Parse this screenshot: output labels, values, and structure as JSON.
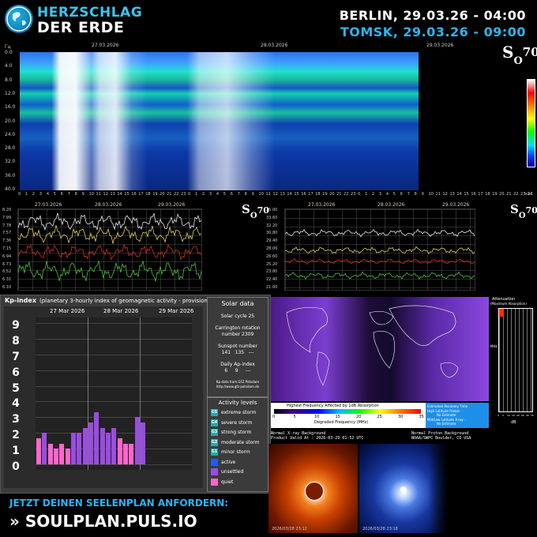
{
  "header": {
    "logo_line1": "HERZSCHLAG",
    "logo_line2": "DER ERDE",
    "city1": "BERLIN, 29.03.26 - 04:00",
    "city2": "TOMSK, 29.03.26 - 09:00"
  },
  "spectrogram": {
    "unit_y": "Гц",
    "unit_x": "час",
    "dates": [
      "27.03.2026",
      "28.03.2026",
      "29.03.2026"
    ],
    "y_ticks": [
      "0.0",
      "4.0",
      "8.0",
      "12.0",
      "16.0",
      "20.0",
      "24.0",
      "28.0",
      "32.0",
      "36.0",
      "40.0"
    ],
    "x_hours": [
      "0",
      "1",
      "2",
      "3",
      "4",
      "5",
      "6",
      "7",
      "8",
      "9",
      "10",
      "11",
      "12",
      "13",
      "14",
      "15",
      "16",
      "17",
      "18",
      "19",
      "20",
      "21",
      "22",
      "23",
      "0",
      "1",
      "2",
      "3",
      "4",
      "5",
      "6",
      "7",
      "8",
      "9",
      "10",
      "11",
      "12",
      "13",
      "14",
      "15",
      "16",
      "17",
      "18",
      "19",
      "20",
      "21",
      "22",
      "23",
      "0",
      "1",
      "2",
      "3",
      "4",
      "5",
      "6",
      "7",
      "8",
      "9",
      "10",
      "11",
      "12",
      "13",
      "14",
      "15",
      "16",
      "17",
      "18",
      "19",
      "20",
      "21",
      "22",
      "23",
      "24"
    ]
  },
  "logo_mark": {
    "s": "S",
    "o": "O",
    "n": "70"
  },
  "plots": {
    "left_dates": [
      "27.03.2026",
      "28.03.2026",
      "29.03.2026"
    ],
    "left_y_ticks": [
      "8.20",
      "7.99",
      "7.78",
      "7.57",
      "7.36",
      "7.15",
      "6.94",
      "6.73",
      "6.52",
      "6.31",
      "6.10"
    ],
    "right_dates": [
      "27.03.2026",
      "28.03.2026",
      "29.03.2026"
    ],
    "right_y_ticks": [
      "35.00",
      "33.60",
      "32.20",
      "30.80",
      "29.40",
      "28.00",
      "26.60",
      "25.20",
      "23.80",
      "22.40",
      "21.00"
    ]
  },
  "kp": {
    "title": "Kp-index",
    "subtitle": "(planetary 3-hourly index of geomagnetic activity - provisional data)",
    "days": [
      "27 Mar 2026",
      "28 Mar 2026",
      "29 Mar 2026"
    ],
    "levels": [
      "9",
      "8",
      "7",
      "6",
      "5",
      "4",
      "3",
      "2",
      "1",
      "0"
    ],
    "values": [
      1.67,
      2.0,
      1.33,
      1.0,
      1.33,
      1.0,
      2.0,
      2.0,
      2.33,
      2.67,
      3.33,
      2.33,
      2.0,
      2.33,
      1.67,
      1.33,
      1.33,
      3.0,
      2.67,
      0,
      0,
      0,
      0,
      0,
      0,
      0,
      0
    ],
    "colors": {
      "quiet": "#ff66cc",
      "unsettled": "#9a4de0",
      "active": "#1e5cff"
    }
  },
  "solar": {
    "title": "Solar data",
    "cycle": "Solar cycle 25",
    "rotation_label": "Carrington rotation",
    "rotation_number": "number 2309",
    "sunspot_label": "Sunspot number",
    "sunspot_values": "141   135   ---",
    "ap_label": "Daily Ap-index",
    "ap_values": "6     9     ---",
    "source1": "Kp-data from GFZ Potsdam",
    "source2": "http://www.gfz-potsdam.de"
  },
  "activity": {
    "title": "Activity levels",
    "rows": [
      {
        "code": "G5",
        "label": "extreme storm",
        "color": "#2aa"
      },
      {
        "code": "G4",
        "label": "severe storm",
        "color": "#2aa"
      },
      {
        "code": "G3",
        "label": "strong storm",
        "color": "#2aa"
      },
      {
        "code": "G2",
        "label": "moderate storm",
        "color": "#2aa"
      },
      {
        "code": "G1",
        "label": "minor storm",
        "color": "#2aa"
      },
      {
        "code": "",
        "label": "active",
        "color": "#1e5cff"
      },
      {
        "code": "",
        "label": "unsettled",
        "color": "#9a4de0"
      },
      {
        "code": "",
        "label": "quiet",
        "color": "#ff66cc"
      }
    ]
  },
  "drap": {
    "legend_title": "Highest Frequency Affected by 1dB Absorption",
    "legend_axis": "Degraded Frequency (MHz)",
    "legend_ticks": [
      "0",
      "5",
      "10",
      "15",
      "20",
      "25",
      "30",
      "35"
    ],
    "recovery_line1": "Estimated Recovery Time",
    "recovery_line2": "High Latitude Proton -",
    "recovery_line3": "No Estimate",
    "recovery_line4": "Mid/Low Latitude X-ray -",
    "recovery_line5": "No Estimate",
    "atten_title": "Attenuation",
    "atten_sub": "(Maximum Absorption)",
    "atten_unit": "dB",
    "atten_x_ticks": [
      "0",
      "5",
      "10",
      "15",
      "20",
      "25",
      "30",
      "35"
    ],
    "mhz_label": "MHz",
    "xray_label1": "Normal X-ray Background",
    "xray_label2": "Product Valid At : 2026-03-29 01:52 UTC",
    "proton_label1": "Normal Proton Background",
    "proton_label2": "NOAA/SWPC Boulder, CO USA"
  },
  "lasco": {
    "left_time": "2026/03/28 23:12",
    "right_time": "2026/03/28 23:18"
  },
  "footer": {
    "cta1": "JETZT DEINEN SEELENPLAN ANFORDERN:",
    "cta2": "» SOULPLAN.PULS.IO"
  }
}
